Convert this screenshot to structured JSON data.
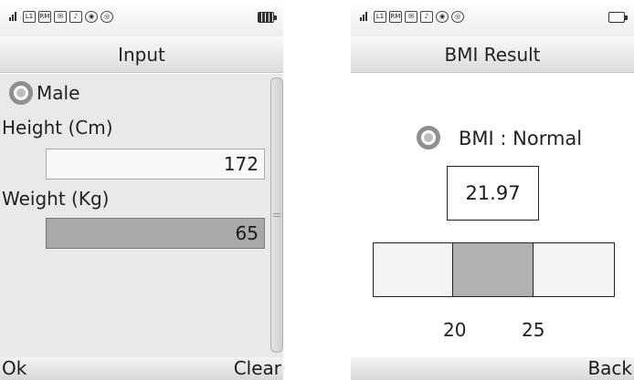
{
  "left_screen": {
    "title": "Input",
    "status_icons": [
      "signal-icon",
      "l1-icon",
      "rm-icon",
      "message-icon",
      "music-icon",
      "globe-icon",
      "alarm-icon"
    ],
    "gender_label": "Male",
    "height_label": "Height (Cm)",
    "height_value": "172",
    "weight_label": "Weight (Kg)",
    "weight_value": "65",
    "softkey_left": "Ok",
    "softkey_right": "Clear"
  },
  "right_screen": {
    "title": "BMI Result",
    "bmi_text": "BMI : Normal",
    "bmi_value": "21.97",
    "range_low": "20",
    "range_high": "25",
    "softkey_right": "Back"
  }
}
